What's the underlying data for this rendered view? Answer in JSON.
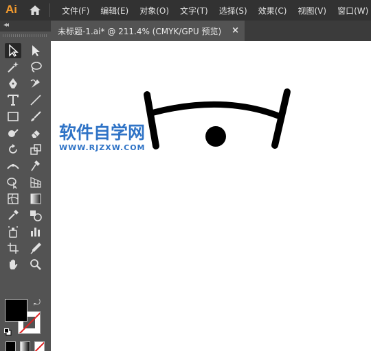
{
  "app": {
    "logo": "Ai"
  },
  "menu": [
    "文件(F)",
    "编辑(E)",
    "对象(O)",
    "文字(T)",
    "选择(S)",
    "效果(C)",
    "视图(V)",
    "窗口(W)",
    "帮"
  ],
  "document_tab": {
    "title": "未标题-1.ai* @ 211.4% (CMYK/GPU 预览)",
    "close": "×"
  },
  "tools_panel": {
    "collapse": "◂◂"
  },
  "watermark": {
    "title": "软件自学网",
    "url": "WWW.RJZXW.COM"
  },
  "colors": {
    "fill": "#000000",
    "stroke": "none",
    "accent": "#2f73c6"
  }
}
